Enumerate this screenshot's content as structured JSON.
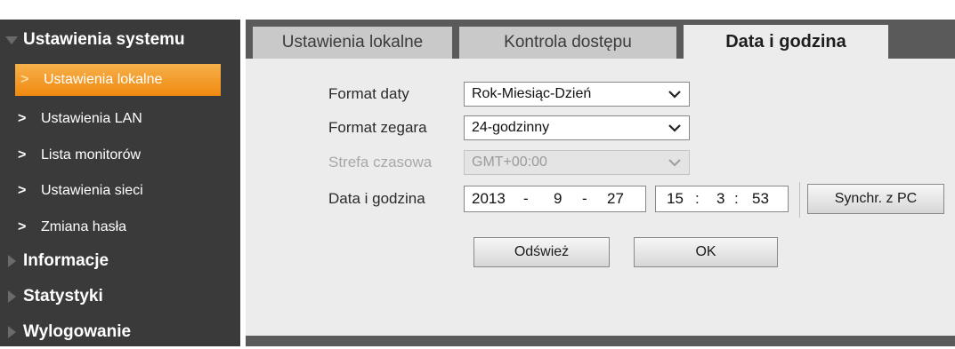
{
  "sidebar": {
    "section_system": "Ustawienia systemu",
    "items": [
      {
        "label": "Ustawienia lokalne",
        "active": true
      },
      {
        "label": "Ustawienia LAN"
      },
      {
        "label": "Lista monitorów"
      },
      {
        "label": "Ustawienia sieci"
      },
      {
        "label": "Zmiana hasła"
      }
    ],
    "section_info": "Informacje",
    "section_stats": "Statystyki",
    "section_logout": "Wylogowanie"
  },
  "tabs": [
    {
      "label": "Ustawienia lokalne"
    },
    {
      "label": "Kontrola dostępu"
    },
    {
      "label": "Data i godzina",
      "active": true
    }
  ],
  "form": {
    "date_format_label": "Format daty",
    "date_format_value": "Rok-Miesiąc-Dzień",
    "clock_format_label": "Format zegara",
    "clock_format_value": "24-godzinny",
    "timezone_label": "Strefa czasowa",
    "timezone_value": "GMT+00:00",
    "datetime_label": "Data i godzina",
    "date": {
      "year": "2013",
      "month": "9",
      "day": "27",
      "sep": "-"
    },
    "time": {
      "hour": "15",
      "minute": "3",
      "second": "53",
      "sep": ":"
    },
    "sync_button": "Synchr. z PC",
    "refresh_button": "Odśwież",
    "ok_button": "OK"
  },
  "colors": {
    "sidebar_bg": "#3a3a3a",
    "active_item": "#f08a10",
    "tabbar_bg": "#5a5a5a",
    "panel_bg": "#ececec"
  }
}
